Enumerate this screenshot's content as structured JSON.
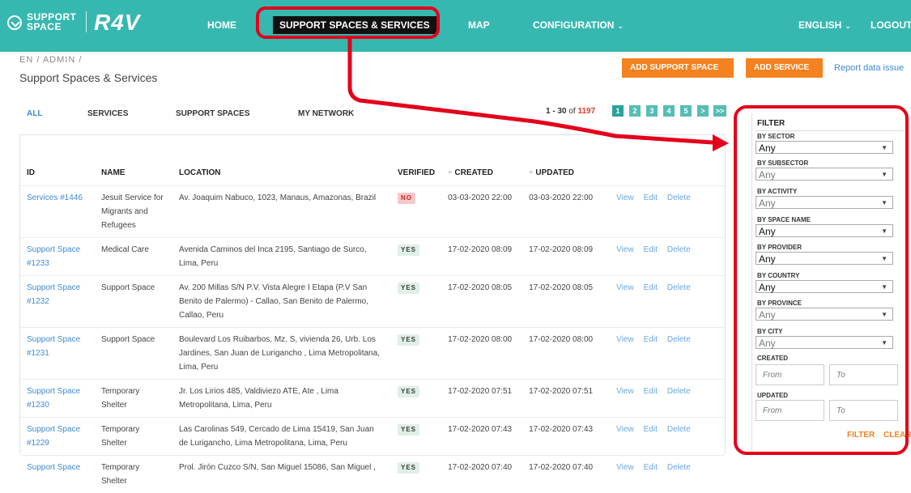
{
  "header": {
    "logo_line1": "SUPPORT",
    "logo_line2": "SPACE",
    "brand": "R4V",
    "nav": {
      "home": "HOME",
      "support": "SUPPORT SPACES & SERVICES",
      "map": "MAP",
      "config": "CONFIGURATION"
    },
    "language": "ENGLISH",
    "logout": "LOGOUT"
  },
  "breadcrumb": "EN / ADMIN /",
  "page_title": "Support Spaces & Services",
  "buttons": {
    "add_space": "ADD SUPPORT SPACE",
    "add_service": "ADD SERVICE",
    "report": "Report data issue"
  },
  "tabs": {
    "all": "ALL",
    "services": "SERVICES",
    "spaces": "SUPPORT SPACES",
    "network": "MY NETWORK"
  },
  "pagination": {
    "range": "1 - 30",
    "of_label": "of",
    "total": "1197",
    "pages": [
      "1",
      "2",
      "3",
      "4",
      "5",
      ">",
      ">>"
    ]
  },
  "table": {
    "headers": {
      "id": "ID",
      "name": "NAME",
      "location": "LOCATION",
      "verified": "VERIFIED",
      "created": "CREATED",
      "updated": "UPDATED"
    },
    "actions": {
      "view": "View",
      "edit": "Edit",
      "delete": "Delete"
    },
    "rows": [
      {
        "id": "Services #1446",
        "name": "Jesuit Service for Migrants and Refugees",
        "location": "Av. Joaquim Nabuco, 1023, Manaus, Amazonas, Brazil",
        "verified": "NO",
        "created": "03-03-2020 22:00",
        "updated": "03-03-2020 22:00"
      },
      {
        "id": "Support Space #1233",
        "name": "Medical Care",
        "location": "Avenida Caminos del Inca 2195, Santiago de Surco, Lima, Peru",
        "verified": "YES",
        "created": "17-02-2020 08:09",
        "updated": "17-02-2020 08:09"
      },
      {
        "id": "Support Space #1232",
        "name": "Support Space",
        "location": "Av. 200 Millas S/N P.V. Vista Alegre I Etapa (P.V San Benito de Palermo) - Callao, San Benito de Palermo, Callao, Peru",
        "verified": "YES",
        "created": "17-02-2020 08:05",
        "updated": "17-02-2020 08:05"
      },
      {
        "id": "Support Space #1231",
        "name": "Support Space",
        "location": "Boulevard Los Ruibarbos, Mz. S, vivienda 26, Urb. Los Jardines, San Juan de Lurigancho , Lima Metropolitana, Lima, Peru",
        "verified": "YES",
        "created": "17-02-2020 08:00",
        "updated": "17-02-2020 08:00"
      },
      {
        "id": "Support Space #1230",
        "name": "Temporary Shelter",
        "location": "Jr. Los Lirios 485, Valdiviezo ATE, Ate , Lima Metropolitana, Lima, Peru",
        "verified": "YES",
        "created": "17-02-2020 07:51",
        "updated": "17-02-2020 07:51"
      },
      {
        "id": "Support Space #1229",
        "name": "Temporary Shelter",
        "location": "Las Carolinas 549, Cercado de Lima 15419, San Juan de Lurigancho, Lima Metropolitana, Lima, Peru",
        "verified": "YES",
        "created": "17-02-2020 07:43",
        "updated": "17-02-2020 07:43"
      },
      {
        "id": "Support Space",
        "name": "Temporary Shelter",
        "location": "Prol. Jirón Cuzco S/N, San Miguel 15086, San Miguel ,",
        "verified": "YES",
        "created": "17-02-2020 07:40",
        "updated": "17-02-2020 07:40"
      }
    ]
  },
  "filter": {
    "title": "FILTER",
    "by_sector": "BY SECTOR",
    "by_subsector": "BY SUBSECTOR",
    "by_activity": "BY ACTIVITY",
    "by_space_name": "BY SPACE NAME",
    "by_provider": "BY PROVIDER",
    "by_country": "BY COUNTRY",
    "by_province": "BY PROVINCE",
    "by_city": "BY CITY",
    "any": "Any",
    "created": "CREATED",
    "updated": "UPDATED",
    "from": "From",
    "to": "To",
    "filter_btn": "FILTER",
    "clear_btn": "CLEAR"
  },
  "colors": {
    "header": "#36b8b0",
    "accent": "#f48220",
    "link": "#3f8bd0",
    "callout": "#e3001b"
  }
}
